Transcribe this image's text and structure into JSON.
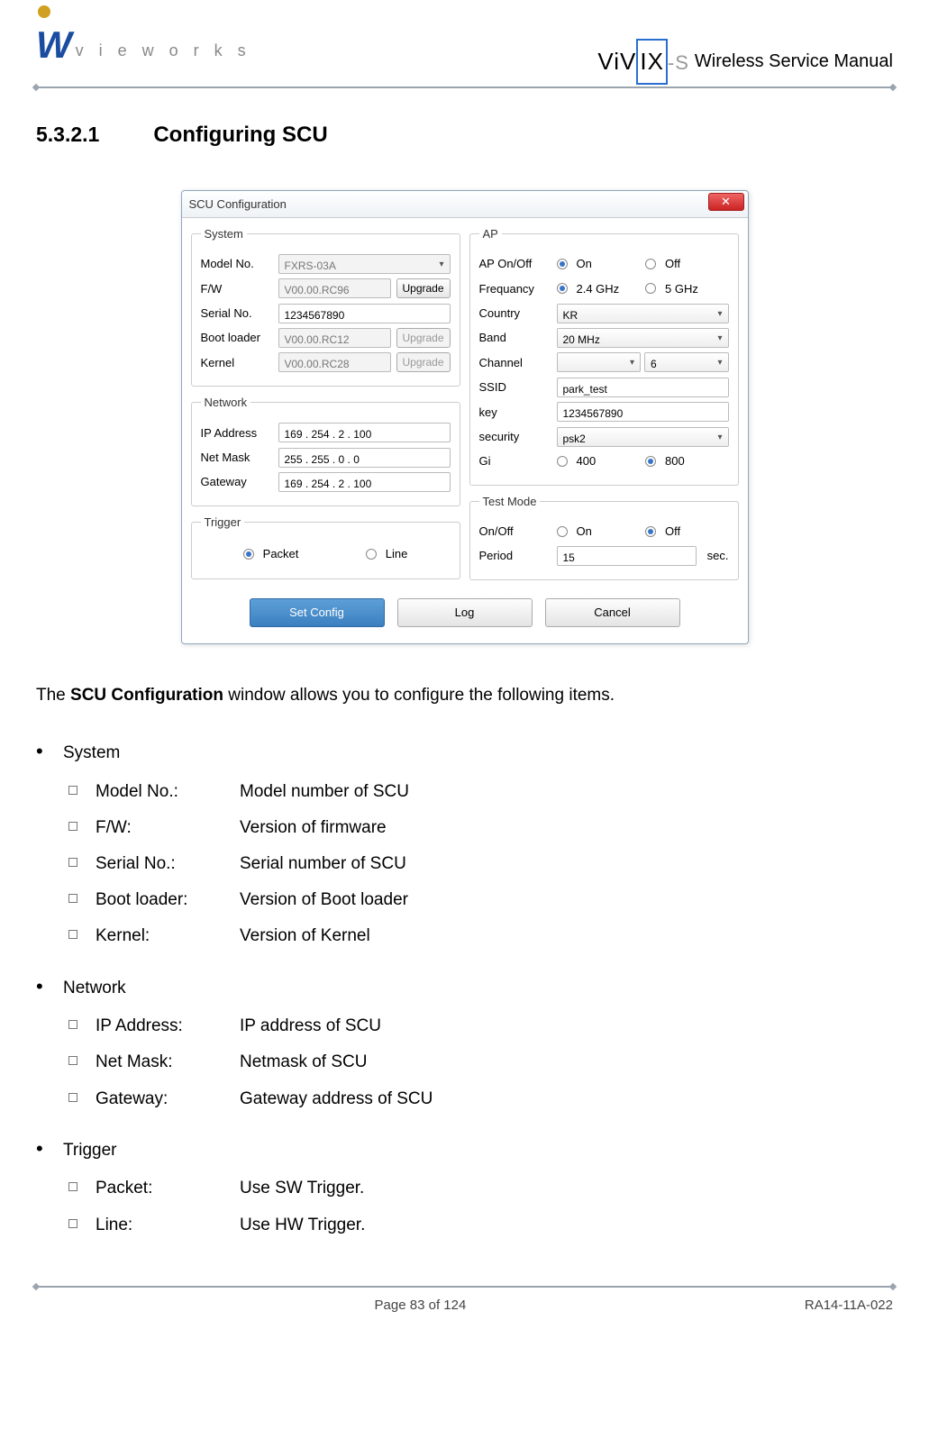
{
  "header": {
    "brand_left": "v i e w o r k s",
    "brand_right_vivix": "ViV",
    "brand_right_i": "IX",
    "brand_right_s": "-S",
    "manual_title": "Wireless Service Manual"
  },
  "section": {
    "num": "5.3.2.1",
    "title": "Configuring SCU"
  },
  "dialog": {
    "title": "SCU Configuration",
    "system": {
      "legend": "System",
      "model_label": "Model No.",
      "model_value": "FXRS-03A",
      "fw_label": "F/W",
      "fw_value": "V00.00.RC96",
      "fw_btn": "Upgrade",
      "serial_label": "Serial No.",
      "serial_value": "1234567890",
      "boot_label": "Boot loader",
      "boot_value": "V00.00.RC12",
      "boot_btn": "Upgrade",
      "kernel_label": "Kernel",
      "kernel_value": "V00.00.RC28",
      "kernel_btn": "Upgrade"
    },
    "network": {
      "legend": "Network",
      "ip_label": "IP Address",
      "ip_value": "169  . 254  .   2    . 100",
      "mask_label": "Net Mask",
      "mask_value": "255  . 255  .   0    .   0",
      "gw_label": "Gateway",
      "gw_value": "169  . 254  .   2    . 100"
    },
    "trigger": {
      "legend": "Trigger",
      "packet": "Packet",
      "line": "Line"
    },
    "ap": {
      "legend": "AP",
      "onoff_label": "AP On/Off",
      "on": "On",
      "off": "Off",
      "freq_label": "Frequancy",
      "freq_a": "2.4 GHz",
      "freq_b": "5 GHz",
      "country_label": "Country",
      "country_value": "KR",
      "band_label": "Band",
      "band_value": "20 MHz",
      "channel_label": "Channel",
      "channel_value": "6",
      "ssid_label": "SSID",
      "ssid_value": "park_test",
      "key_label": "key",
      "key_value": "1234567890",
      "security_label": "security",
      "security_value": "psk2",
      "gi_label": "Gi",
      "gi_a": "400",
      "gi_b": "800"
    },
    "testmode": {
      "legend": "Test Mode",
      "onoff_label": "On/Off",
      "on": "On",
      "off": "Off",
      "period_label": "Period",
      "period_value": "15",
      "period_unit": "sec."
    },
    "buttons": {
      "set": "Set Config",
      "log": "Log",
      "cancel": "Cancel"
    }
  },
  "intro_pre": "The ",
  "intro_bold": "SCU Configuration",
  "intro_post": " window allows you to configure the following items.",
  "list": [
    {
      "head": "System",
      "items": [
        {
          "term": "Model No.:",
          "desc": "Model number of SCU"
        },
        {
          "term": "F/W:",
          "desc": "Version of firmware"
        },
        {
          "term": "Serial No.:",
          "desc": "Serial number of SCU"
        },
        {
          "term": "Boot loader:",
          "desc": "Version of Boot loader"
        },
        {
          "term": "Kernel:",
          "desc": "Version of Kernel"
        }
      ]
    },
    {
      "head": "Network",
      "items": [
        {
          "term": "IP Address:",
          "desc": "IP address of SCU"
        },
        {
          "term": "Net Mask:",
          "desc": "Netmask of SCU"
        },
        {
          "term": "Gateway:",
          "desc": "Gateway address of SCU"
        }
      ]
    },
    {
      "head": "Trigger",
      "items": [
        {
          "term": "Packet:",
          "desc": "Use SW Trigger."
        },
        {
          "term": "Line:",
          "desc": "Use HW Trigger."
        }
      ]
    }
  ],
  "footer": {
    "page": "Page 83 of 124",
    "doc": "RA14-11A-022"
  }
}
